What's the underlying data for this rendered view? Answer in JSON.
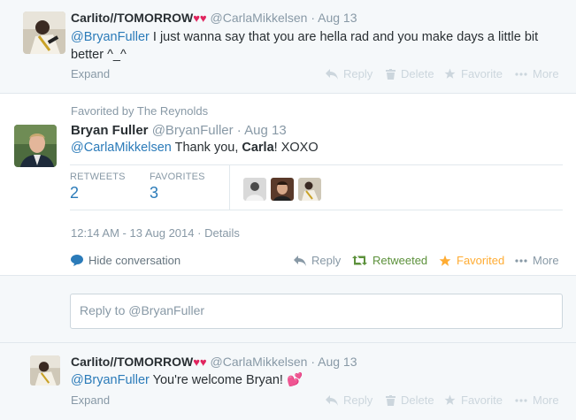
{
  "tweets": [
    {
      "fullname": "Carlito//TOMORROW",
      "hearts": "♥♥",
      "handle": "@CarlaMikkelsen",
      "dot": "·",
      "time": "Aug 13",
      "mention": "@BryanFuller",
      "text_line1": " I just wanna say that you are hella rad and you make days a little bit",
      "text_line2": "better ^_^",
      "expand": "Expand",
      "actions": {
        "reply": "Reply",
        "delete": "Delete",
        "favorite": "Favorite",
        "more": "More"
      }
    },
    {
      "context": "Favorited by The Reynolds",
      "fullname": "Bryan Fuller",
      "handle": "@BryanFuller",
      "dot": "·",
      "time": "Aug 13",
      "mention": "@CarlaMikkelsen",
      "text_pre": " Thank you, ",
      "text_bold": "Carla",
      "text_post": "! XOXO",
      "stats": {
        "retweets_label": "RETWEETS",
        "retweets": "2",
        "favorites_label": "FAVORITES",
        "favorites": "3"
      },
      "meta": {
        "time": "12:14 AM - 13 Aug 2014",
        "dot": "·",
        "details": "Details"
      },
      "hide_conversation": "Hide conversation",
      "actions": {
        "reply": "Reply",
        "retweeted": "Retweeted",
        "favorited": "Favorited",
        "more": "More"
      }
    },
    {
      "fullname": "Carlito//TOMORROW",
      "hearts": "♥♥",
      "handle": "@CarlaMikkelsen",
      "dot": "·",
      "time": "Aug 13",
      "mention": "@BryanFuller",
      "text": " You're welcome Bryan! ",
      "emoji": "💕",
      "expand": "Expand",
      "actions": {
        "reply": "Reply",
        "delete": "Delete",
        "favorite": "Favorite",
        "more": "More"
      }
    }
  ],
  "reply_box": {
    "placeholder": "Reply to @BryanFuller"
  },
  "colors": {
    "link": "#2b7bb9",
    "retweeted": "#5c913b",
    "favorited": "#ffac33",
    "muted": "#8899a6"
  },
  "icons": [
    "reply-icon",
    "trash-icon",
    "star-icon",
    "more-dots-icon",
    "retweet-icon",
    "speech-bubble-icon"
  ]
}
